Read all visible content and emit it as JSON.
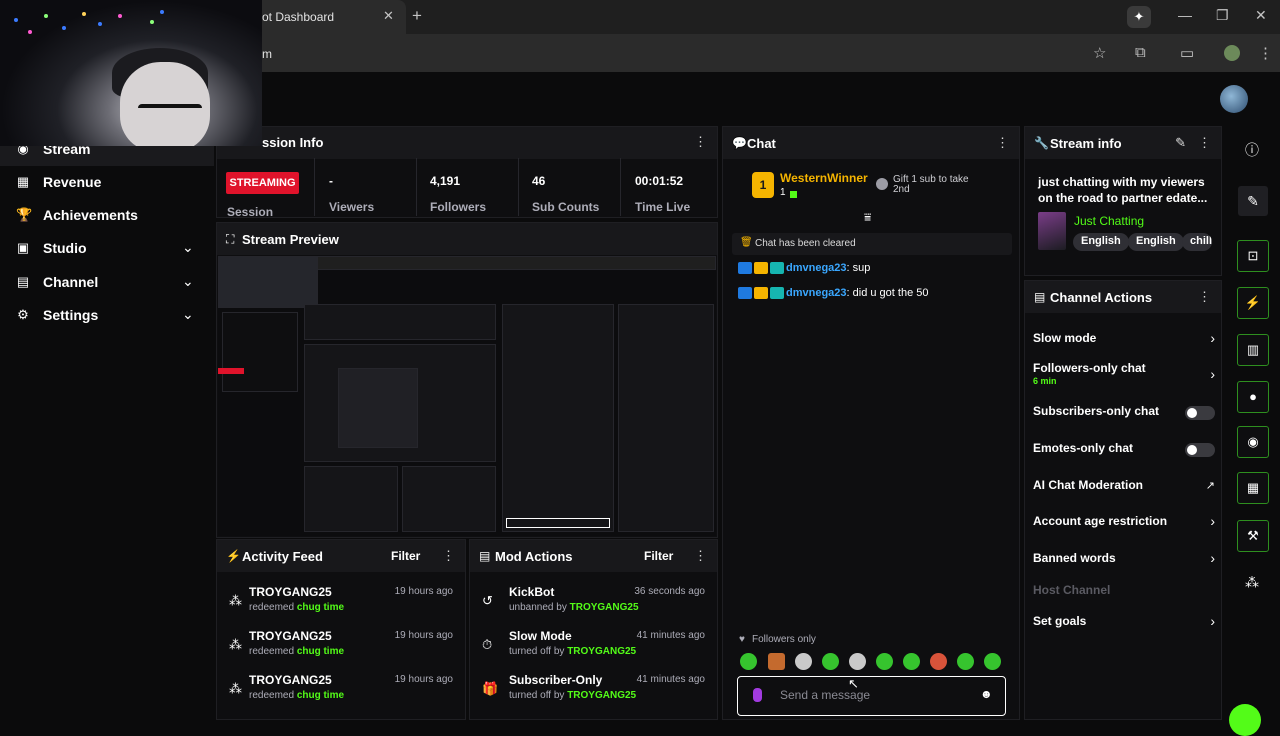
{
  "browser": {
    "tab_title": "ot Dashboard",
    "tab_close": "✕",
    "new_tab": "+",
    "url": "m",
    "assistant_icon": "✦",
    "minimize": "—",
    "maximize": "❐",
    "close": "✕"
  },
  "sidebar": {
    "items": [
      {
        "label": "Stream",
        "icon": "◉"
      },
      {
        "label": "Revenue",
        "icon": "▦"
      },
      {
        "label": "Achievements",
        "icon": "🏆"
      },
      {
        "label": "Studio",
        "icon": "▣",
        "chevron": "⌄"
      },
      {
        "label": "Channel",
        "icon": "▤",
        "chevron": "⌄"
      },
      {
        "label": "Settings",
        "icon": "⚙",
        "chevron": "⌄"
      }
    ]
  },
  "session": {
    "title": "ssion Info",
    "status": "STREAMING",
    "session_label": "Session",
    "stats": [
      {
        "value": "-",
        "label": "Viewers"
      },
      {
        "value": "4,191",
        "label": "Followers"
      },
      {
        "value": "46",
        "label": "Sub Counts"
      },
      {
        "value": "00:01:52",
        "label": "Time Live"
      }
    ]
  },
  "preview": {
    "title": "Stream Preview"
  },
  "activity": {
    "title": "Activity Feed",
    "filter": "Filter",
    "rows": [
      {
        "name": "TROYGANG25",
        "action": "redeemed",
        "item": "chug time",
        "time": "19 hours ago"
      },
      {
        "name": "TROYGANG25",
        "action": "redeemed",
        "item": "chug time",
        "time": "19 hours ago"
      },
      {
        "name": "TROYGANG25",
        "action": "redeemed",
        "item": "chug time",
        "time": "19 hours ago"
      }
    ]
  },
  "mod_actions": {
    "title": "Mod Actions",
    "filter": "Filter",
    "rows": [
      {
        "name": "KickBot",
        "action": "unbanned by",
        "by": "TROYGANG25",
        "time": "36 seconds ago",
        "icon": "↺"
      },
      {
        "name": "Slow Mode",
        "action": "turned off by",
        "by": "TROYGANG25",
        "time": "41 minutes ago",
        "icon": "⏱"
      },
      {
        "name": "Subscriber-Only",
        "action": "turned off by",
        "by": "TROYGANG25",
        "time": "41 minutes ago",
        "icon": "🎁"
      }
    ]
  },
  "chat": {
    "title": "Chat",
    "top_gifter": {
      "name": "WesternWinner",
      "rank": "1",
      "count": "1"
    },
    "gift_prompt": "Gift 1 sub to take 2nd",
    "cleared": "Chat has been cleared",
    "messages": [
      {
        "user": "dmvnega23",
        "text": ": sup"
      },
      {
        "user": "dmvnega23",
        "text": ": did u got the 50"
      }
    ],
    "mode_note": "Followers only",
    "input_placeholder": "Send a message"
  },
  "stream_info": {
    "title": "Stream info",
    "stream_title": "just chatting with my viewers on the road to partner edate...",
    "category": "Just Chatting",
    "tags": [
      "English",
      "English",
      "chill"
    ]
  },
  "channel_actions": {
    "title": "Channel Actions",
    "items": [
      {
        "label": "Slow mode",
        "control": "chevron"
      },
      {
        "label": "Followers-only chat",
        "sub": "6 min",
        "control": "chevron"
      },
      {
        "label": "Subscribers-only chat",
        "control": "toggle",
        "on": false
      },
      {
        "label": "Emotes-only chat",
        "control": "toggle",
        "on": false
      },
      {
        "label": "AI Chat Moderation",
        "control": "external"
      },
      {
        "label": "Account age restriction",
        "control": "chevron"
      },
      {
        "label": "Banned words",
        "control": "chevron"
      },
      {
        "label": "Host Channel",
        "control": "none",
        "disabled": true
      },
      {
        "label": "Set goals",
        "control": "chevron"
      }
    ]
  },
  "colors": {
    "brand_green": "#53fc18",
    "live_red": "#e0132b",
    "username_blue": "#3aa7ff"
  }
}
